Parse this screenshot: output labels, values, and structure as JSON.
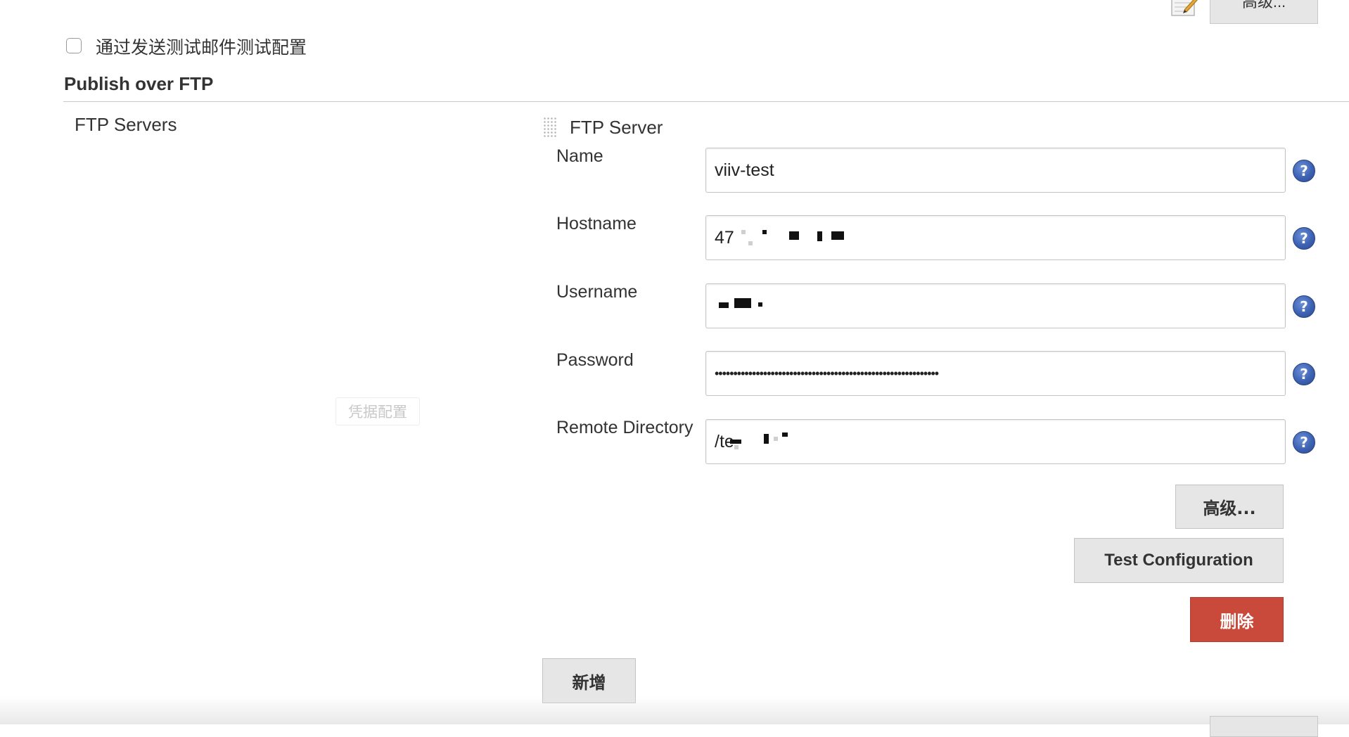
{
  "top": {
    "advanced_label": "高级..."
  },
  "email_test": {
    "checkbox_label": "通过发送测试邮件测试配置",
    "checked": false
  },
  "section": {
    "title": "Publish over FTP"
  },
  "ftp_servers": {
    "label": "FTP Servers",
    "credential_button": "凭据配置",
    "server": {
      "title": "FTP Server",
      "fields": {
        "name": {
          "label": "Name",
          "value": "viiv-test"
        },
        "hostname": {
          "label": "Hostname",
          "value": "47"
        },
        "username": {
          "label": "Username",
          "value": ""
        },
        "password": {
          "label": "Password",
          "value": "••••••••••••••••••••••••••••••••••••••••••••••••••••••••••••"
        },
        "remote_directory": {
          "label": "Remote Directory",
          "value": "/te"
        }
      },
      "help_glyph": "?",
      "advanced_label": "高级...",
      "test_label": "Test Configuration",
      "delete_label": "删除"
    },
    "add_label": "新增"
  },
  "colors": {
    "delete_button": "#c9493a",
    "help_icon": "#3d62b3",
    "button_bg": "#e6e6e6"
  },
  "icons": [
    "notepad-icon",
    "drag-handle-icon",
    "help-icon"
  ]
}
